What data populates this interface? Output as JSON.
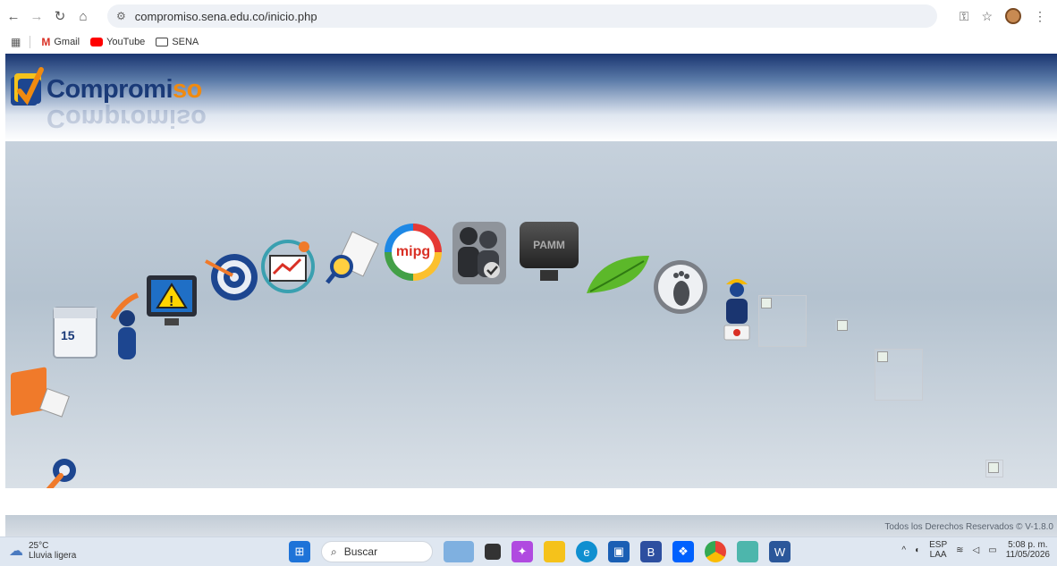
{
  "browser": {
    "url": "compromiso.sena.edu.co/inicio.php",
    "bookmarks": [
      "Gmail",
      "YouTube",
      "SENA"
    ]
  },
  "site": {
    "logo_main": "Compromiso",
    "logo_prefix": "Compromi",
    "logo_accent": "so",
    "pamm_label": "PAMM",
    "mipg_label": "mipg",
    "calendar_day": "15",
    "footer_text": "Todos los Derechos Reservados © V-1.8.0"
  },
  "taskbar": {
    "temperature": "25°C",
    "weather": "Lluvia ligera",
    "search_placeholder": "Buscar",
    "lang_top": "ESP",
    "lang_bottom": "LAA",
    "time": "5:08 p. m.",
    "date": "11/05/2026"
  },
  "colors": {
    "header_dark": "#1a3570",
    "logo_blue": "#1a3a78",
    "logo_orange": "#f08a10"
  }
}
